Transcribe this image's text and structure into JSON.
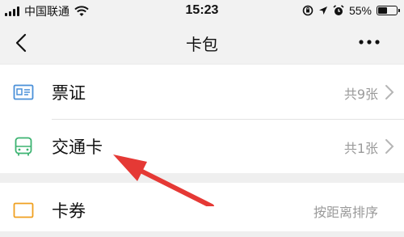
{
  "status_bar": {
    "carrier": "中国联通",
    "time": "15:23",
    "battery": "55%",
    "battery_level": 0.55
  },
  "nav": {
    "title": "卡包"
  },
  "list": {
    "items": [
      {
        "label": "票证",
        "count": "共9张",
        "icon": "ticket-icon"
      },
      {
        "label": "交通卡",
        "count": "共1张",
        "icon": "bus-icon"
      }
    ],
    "next_item": {
      "label": "卡券",
      "count": "按距离排序",
      "icon": "coupon-icon"
    }
  },
  "colors": {
    "ticket_icon": "#4a90d9",
    "bus_icon": "#3cb371",
    "coupon_icon": "#f0a020",
    "arrow": "#e53935"
  }
}
